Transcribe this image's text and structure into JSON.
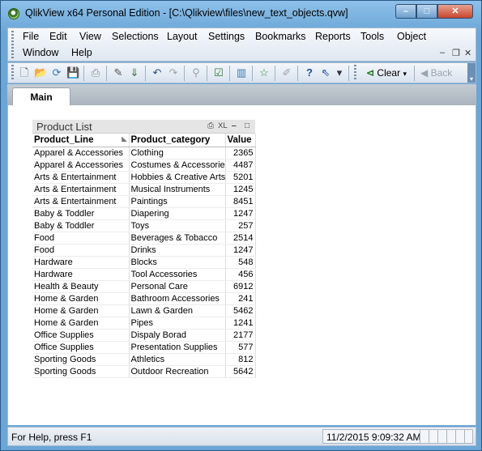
{
  "window": {
    "title": "QlikView x64 Personal Edition - [C:\\Qlikview\\files\\new_text_objects.qvw]",
    "controls": {
      "minimize": "–",
      "maximize": "□",
      "close": "✕"
    }
  },
  "menu": {
    "row1": [
      "File",
      "Edit",
      "View",
      "Selections",
      "Layout",
      "Settings",
      "Bookmarks",
      "Reports",
      "Tools",
      "Object"
    ],
    "row2": [
      "Window",
      "Help"
    ],
    "mdi": {
      "minimize": "–",
      "restore": "❐",
      "close": "✕"
    }
  },
  "toolbar": {
    "clear_label": "Clear",
    "back_label": "Back"
  },
  "tabs": [
    {
      "label": "Main"
    }
  ],
  "table_box": {
    "title": "Product List",
    "caption_icons": {
      "print": "⎙",
      "xl": "XL",
      "minimize": "‒",
      "maximize": "□"
    },
    "columns": [
      "Product_Line",
      "Product_category",
      "Value"
    ],
    "rows": [
      [
        "Apparel & Accessories",
        "Clothing",
        "2365"
      ],
      [
        "Apparel & Accessories",
        "Costumes & Accessories",
        "4487"
      ],
      [
        "Arts & Entertainment",
        "Hobbies & Creative Arts",
        "5201"
      ],
      [
        "Arts & Entertainment",
        "Musical Instruments",
        "1245"
      ],
      [
        "Arts & Entertainment",
        "Paintings",
        "8451"
      ],
      [
        "Baby & Toddler",
        "Diapering",
        "1247"
      ],
      [
        "Baby & Toddler",
        "Toys",
        "257"
      ],
      [
        "Food",
        "Beverages & Tobacco",
        "2514"
      ],
      [
        "Food",
        "Drinks",
        "1247"
      ],
      [
        "Hardware",
        "Blocks",
        "548"
      ],
      [
        "Hardware",
        "Tool Accessories",
        "456"
      ],
      [
        "Health & Beauty",
        "Personal Care",
        "6912"
      ],
      [
        "Home & Garden",
        "Bathroom Accessories",
        "241"
      ],
      [
        "Home & Garden",
        "Lawn & Garden",
        "5462"
      ],
      [
        "Home & Garden",
        "Pipes",
        "1241"
      ],
      [
        "Office Supplies",
        "Dispaly Borad",
        "2177"
      ],
      [
        "Office Supplies",
        "Presentation Supplies",
        "577"
      ],
      [
        "Sporting Goods",
        "Athletics",
        "812"
      ],
      [
        "Sporting Goods",
        "Outdoor Recreation",
        "5642"
      ]
    ]
  },
  "status": {
    "help_text": "For Help, press F1",
    "timestamp": "11/2/2015 9:09:32 AM"
  }
}
